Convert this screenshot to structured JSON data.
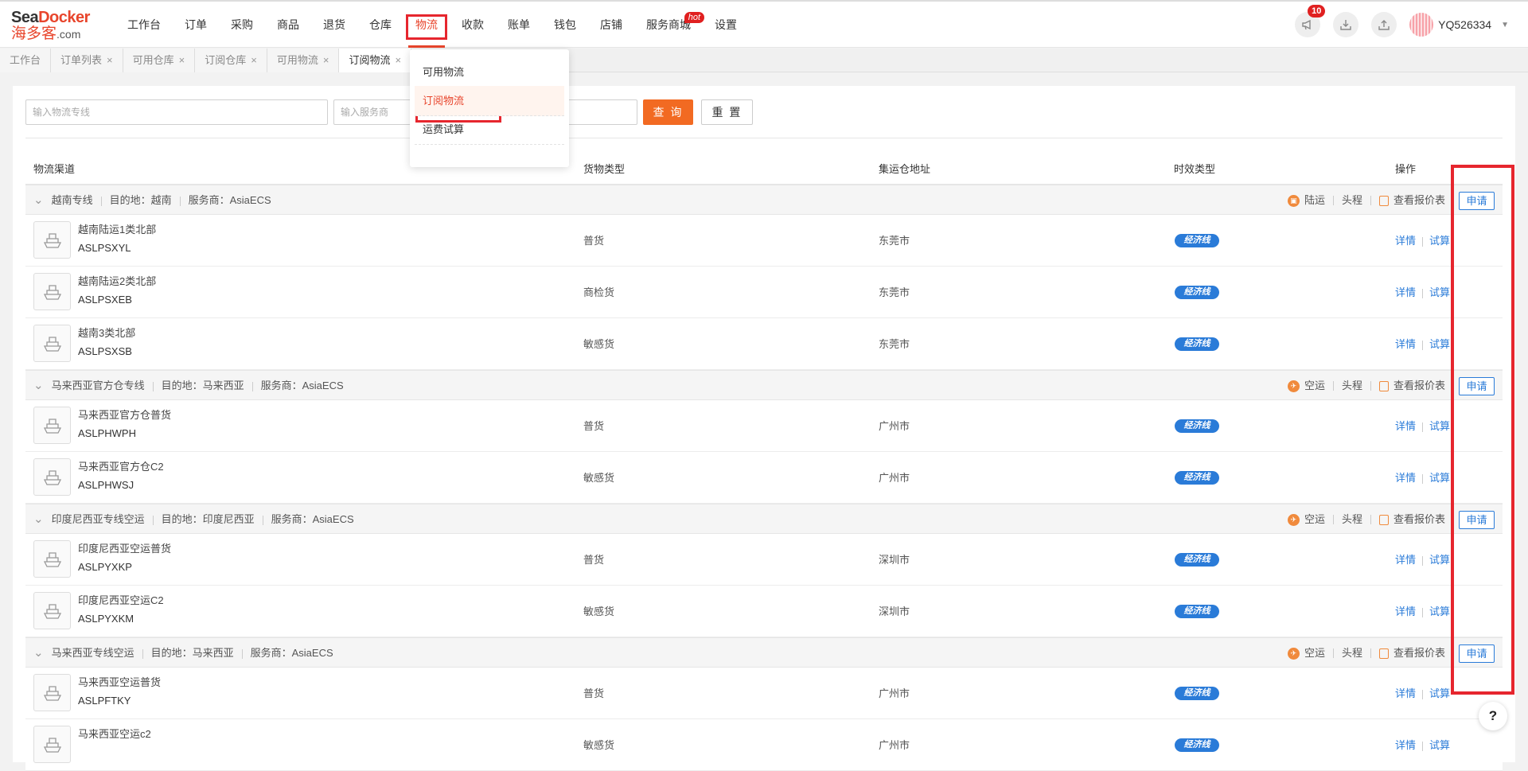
{
  "logo": {
    "brand_a": "Sea",
    "brand_b": "Docker",
    "cn": "海多客",
    "domain": ".com"
  },
  "nav": [
    {
      "label": "工作台"
    },
    {
      "label": "订单"
    },
    {
      "label": "采购"
    },
    {
      "label": "商品"
    },
    {
      "label": "退货"
    },
    {
      "label": "仓库"
    },
    {
      "label": "物流",
      "active": true
    },
    {
      "label": "收款"
    },
    {
      "label": "账单"
    },
    {
      "label": "钱包"
    },
    {
      "label": "店铺"
    },
    {
      "label": "服务商城",
      "badge": "hot"
    },
    {
      "label": "设置"
    }
  ],
  "header_right": {
    "notification_count": "10",
    "username": "YQ526334"
  },
  "tabs": [
    {
      "label": "工作台",
      "closable": false
    },
    {
      "label": "订单列表",
      "closable": true
    },
    {
      "label": "可用仓库",
      "closable": true
    },
    {
      "label": "订阅仓库",
      "closable": true
    },
    {
      "label": "可用物流",
      "closable": true
    },
    {
      "label": "订阅物流",
      "closable": true,
      "current": true
    }
  ],
  "dropdown": {
    "items": [
      {
        "label": "可用物流"
      },
      {
        "label": "订阅物流",
        "selected": true
      },
      {
        "label": "运费试算"
      }
    ]
  },
  "filters": {
    "line_placeholder": "输入物流专线",
    "provider_placeholder": "输入服务商",
    "query_label": "查 询",
    "reset_label": "重 置"
  },
  "table": {
    "headers": {
      "channel": "物流渠道",
      "cargo": "货物类型",
      "address": "集运仓地址",
      "timeliness": "时效类型",
      "ops": "操作"
    },
    "groups": [
      {
        "name": "越南专线",
        "dest": "目的地：越南",
        "provider": "服务商：AsiaECS",
        "transport": "陆运",
        "leg": "头程",
        "quote": "查看报价表",
        "apply": "申请",
        "rows": [
          {
            "name": "越南陆运1类北部",
            "code": "ASLPSXYL",
            "cargo": "普货",
            "address": "东莞市",
            "tag": "经济线"
          },
          {
            "name": "越南陆运2类北部",
            "code": "ASLPSXEB",
            "cargo": "商检货",
            "address": "东莞市",
            "tag": "经济线"
          },
          {
            "name": "越南3类北部",
            "code": "ASLPSXSB",
            "cargo": "敏感货",
            "address": "东莞市",
            "tag": "经济线"
          }
        ]
      },
      {
        "name": "马来西亚官方仓专线",
        "dest": "目的地：马来西亚",
        "provider": "服务商：AsiaECS",
        "transport": "空运",
        "leg": "头程",
        "quote": "查看报价表",
        "apply": "申请",
        "rows": [
          {
            "name": "马来西亚官方仓普货",
            "code": "ASLPHWPH",
            "cargo": "普货",
            "address": "广州市",
            "tag": "经济线"
          },
          {
            "name": "马来西亚官方仓C2",
            "code": "ASLPHWSJ",
            "cargo": "敏感货",
            "address": "广州市",
            "tag": "经济线"
          }
        ]
      },
      {
        "name": "印度尼西亚专线空运",
        "dest": "目的地：印度尼西亚",
        "provider": "服务商：AsiaECS",
        "transport": "空运",
        "leg": "头程",
        "quote": "查看报价表",
        "apply": "申请",
        "rows": [
          {
            "name": "印度尼西亚空运普货",
            "code": "ASLPYXKP",
            "cargo": "普货",
            "address": "深圳市",
            "tag": "经济线"
          },
          {
            "name": "印度尼西亚空运C2",
            "code": "ASLPYXKM",
            "cargo": "敏感货",
            "address": "深圳市",
            "tag": "经济线"
          }
        ]
      },
      {
        "name": "马来西亚专线空运",
        "dest": "目的地：马来西亚",
        "provider": "服务商：AsiaECS",
        "transport": "空运",
        "leg": "头程",
        "quote": "查看报价表",
        "apply": "申请",
        "rows": [
          {
            "name": "马来西亚空运普货",
            "code": "ASLPFTKY",
            "cargo": "普货",
            "address": "广州市",
            "tag": "经济线"
          },
          {
            "name": "马来西亚空运c2",
            "code": "",
            "cargo": "敏感货",
            "address": "广州市",
            "tag": "经济线"
          }
        ]
      }
    ],
    "row_links": {
      "detail": "详情",
      "trial": "试算"
    }
  },
  "help_label": "?"
}
